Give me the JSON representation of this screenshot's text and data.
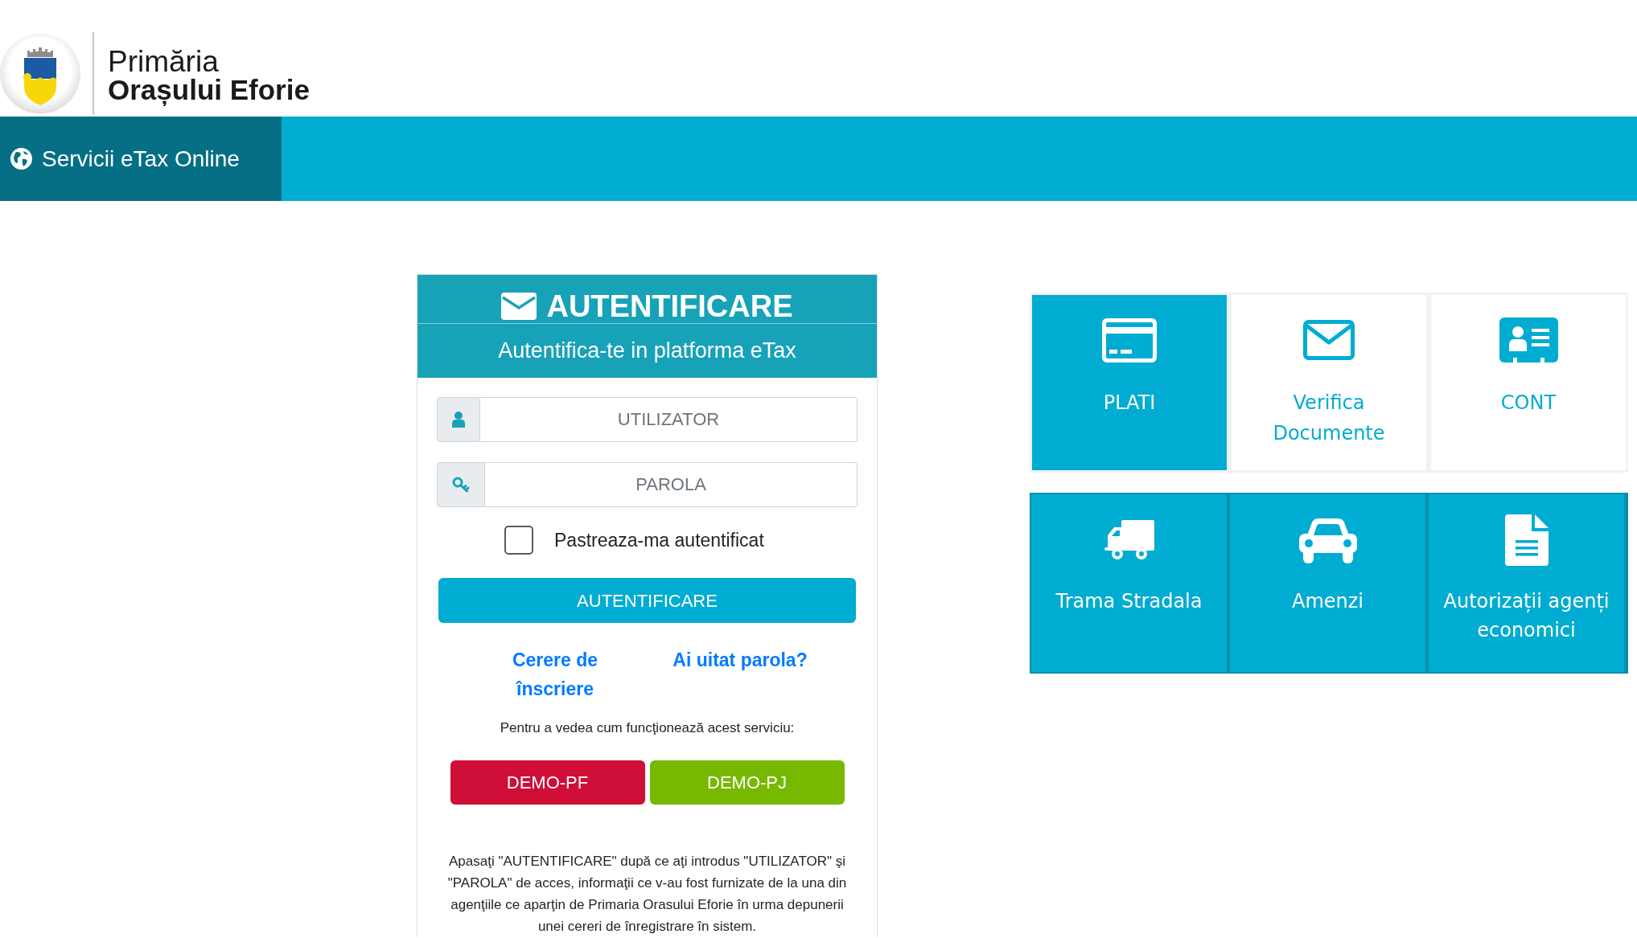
{
  "header": {
    "logo_text": {
      "line_1": "Primăria",
      "line_2": "Orașului Eforie"
    }
  },
  "nav": {
    "title": "Servicii eTax Online"
  },
  "login": {
    "title": "AUTENTIFICARE",
    "subtitle": "Autentifica-te in platforma eTax",
    "fields": [
      {
        "kind": "user",
        "placeholder": "UTILIZATOR"
      },
      {
        "kind": "password",
        "placeholder": "PAROLA"
      }
    ],
    "remember": {
      "label": "Pastreaza-ma autentificat",
      "checked": false
    },
    "submit": "AUTENTIFICARE",
    "links": [
      "Cerere de înscriere",
      "Ai uitat parola?"
    ],
    "demo_intro": "Pentru a vedea cum funcţionează acest serviciu:",
    "demo_buttons": [
      {
        "label": "DEMO-PF",
        "color": "#cf0f38"
      },
      {
        "label": "DEMO-PJ",
        "color": "#77b800"
      }
    ],
    "note": "Apasaţi \"AUTENTIFICARE\" după ce aţi introdus \"UTILIZATOR\" şi \"PAROLA\" de acces, informaţii ce v-au fost furnizate de la una din agenţiile ce aparţin de Primaria Orasului Eforie în urma depunerii unei cereri de înregistrare în sistem."
  },
  "tile_groups": [
    {
      "kind": "outlined",
      "tiles": [
        {
          "label": "PLATI",
          "selected": true
        },
        {
          "label": "Verifica Documente",
          "selected": false
        },
        {
          "label": "CONT",
          "selected": false
        }
      ]
    },
    {
      "kind": "filled",
      "tiles": [
        {
          "label": "Trama Stradala",
          "selected": false
        },
        {
          "label": "Amenzi",
          "selected": false
        },
        {
          "label": "Autorizații agenți economici",
          "selected": false
        }
      ]
    }
  ]
}
